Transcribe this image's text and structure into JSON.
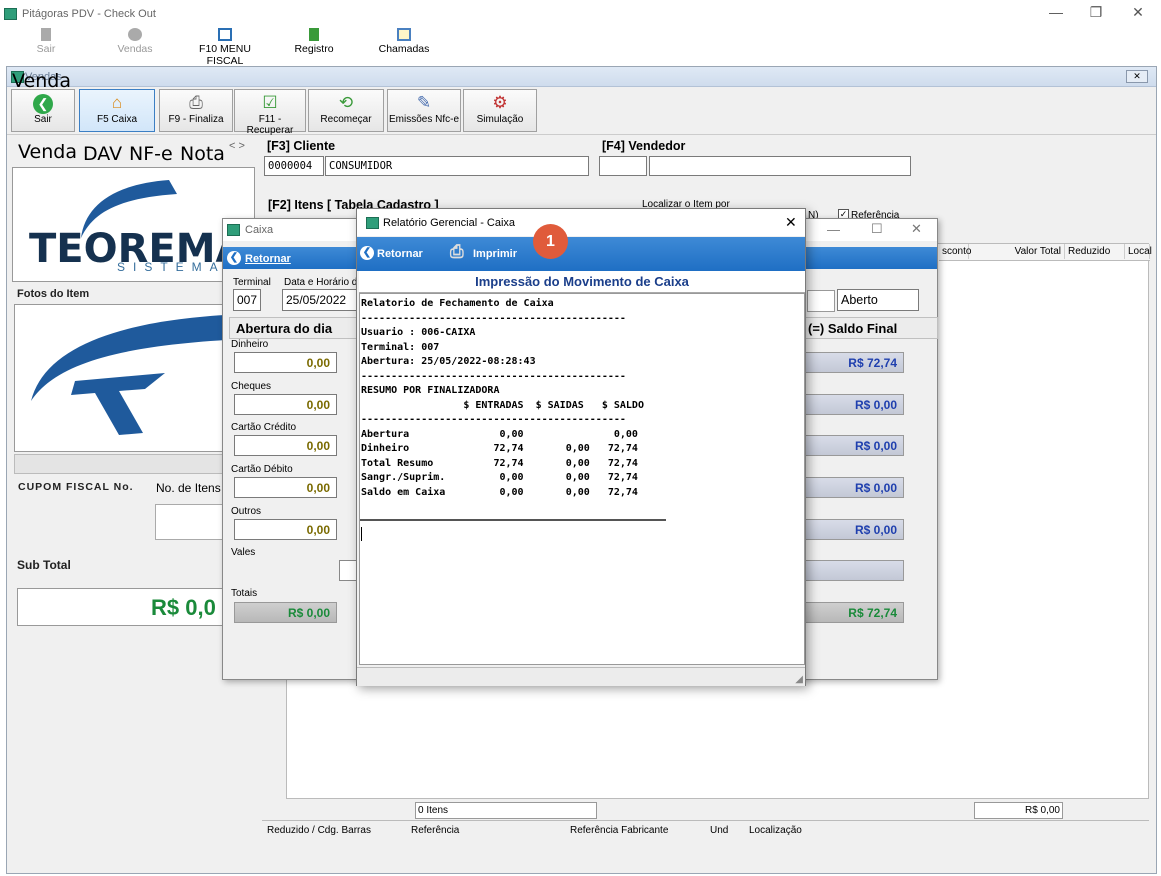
{
  "app": {
    "title": "Pitágoras PDV - Check Out",
    "min": "—",
    "max": "❐",
    "close": "✕"
  },
  "menu": {
    "sair": "Sair",
    "vendas": "Vendas",
    "f10": "F10 MENU FISCAL",
    "registro": "Registro",
    "chamadas": "Chamadas"
  },
  "vendas": {
    "title": "Vendas",
    "toolbar": [
      "Sair",
      "F5 Caixa",
      "F9 - Finaliza",
      "F11 - Recuperar",
      "Recomeçar",
      "Emissões Nfc-e",
      "Simulação"
    ],
    "tabs": [
      "Venda",
      "DAV",
      "NF-e",
      "Nota"
    ],
    "tab_arrows": "< >",
    "logo": {
      "word": "TEOREMA",
      "sub": "SISTEMA"
    },
    "fotos": "Fotos do Item",
    "cupom": "CUPOM FISCAL No.",
    "no_itens": "No. de Itens",
    "subtotal_label": "Sub Total",
    "subtotal_value": "R$ 0,0",
    "cliente_label": "[F3] Cliente",
    "cliente_code": "0000004",
    "cliente_name": "CONSUMIDOR",
    "vendedor_label": "[F4] Vendedor",
    "itens_label": "[F2] Itens [ Tabela Cadastro ]",
    "localizar": "Localizar o Item por",
    "referencia": "Referência",
    "ref_prefix": "N)",
    "grid_cols": [
      "sconto",
      "Valor Total",
      "Reduzido",
      "Local"
    ],
    "itens_count": "0 Itens",
    "total_itens": "R$ 0,00",
    "bottom_cols": [
      "Reduzido / Cdg. Barras",
      "Referência",
      "Referência Fabricante",
      "Und",
      "Localização"
    ]
  },
  "caixa": {
    "title": "Caixa",
    "retornar": "Retornar",
    "terminal_label": "Terminal",
    "terminal": "007",
    "data_label": "Data e Horário d",
    "data": "25/05/2022",
    "status": "Aberto",
    "abertura": "Abertura do dia",
    "saldo": "(=) Saldo Final",
    "rows": [
      {
        "label": "Dinheiro",
        "open": "0,00",
        "final": "R$ 72,74"
      },
      {
        "label": "Cheques",
        "open": "0,00",
        "final": "R$ 0,00"
      },
      {
        "label": "Cartão Crédito",
        "open": "0,00",
        "final": "R$ 0,00"
      },
      {
        "label": "Cartão Débito",
        "open": "0,00",
        "final": "R$ 0,00"
      },
      {
        "label": "Outros",
        "open": "0,00",
        "final": "R$ 0,00"
      }
    ],
    "vales": "Vales",
    "totais": "Totais",
    "totais_open": "R$ 0,00",
    "totais_final": "R$ 72,74"
  },
  "relatorio": {
    "title": "Relatório Gerencial - Caixa",
    "retornar": "Retornar",
    "imprimir": "Imprimir",
    "heading": "Impressão do Movimento de Caixa",
    "text": "Relatorio de Fechamento de Caixa\n--------------------------------------------\nUsuario : 006-CAIXA\nTerminal: 007\nAbertura: 25/05/2022-08:28:43\n--------------------------------------------\nRESUMO POR FINALIZADORA\n                 $ ENTRADAS  $ SAIDAS   $ SALDO\n--------------------------------------------\nAbertura               0,00               0,00\nDinheiro              72,74       0,00   72,74\nTotal Resumo          72,74       0,00   72,74\nSangr./Suprim.         0,00       0,00   72,74\nSaldo em Caixa         0,00       0,00   72,74"
  },
  "badge": "1"
}
